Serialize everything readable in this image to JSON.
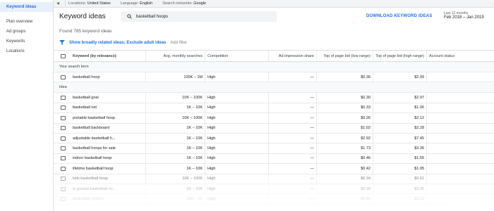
{
  "sidebar": {
    "items": [
      {
        "label": "Keyword ideas",
        "active": true
      },
      {
        "label": "Plan overview",
        "active": false
      },
      {
        "label": "Ad groups",
        "active": false
      },
      {
        "label": "Keywords",
        "active": false
      },
      {
        "label": "Locations",
        "active": false
      }
    ]
  },
  "topbar": {
    "collapse_icon": "◀",
    "locations_label": "Locations:",
    "locations_value": "United States",
    "language_label": "Language:",
    "language_value": "English",
    "networks_label": "Search networks:",
    "networks_value": "Google"
  },
  "header": {
    "title": "Keyword ideas",
    "search_value": "basketball hoops",
    "download_label": "DOWNLOAD KEYWORD IDEAS",
    "date_sub": "Last 12 months",
    "date_value": "Feb 2018 – Jan 2019"
  },
  "found_text": "Found 785 keyword ideas",
  "filter": {
    "broad_label": "Show broadly related ideas; Exclude adult ideas",
    "add_label": "Add filter"
  },
  "table": {
    "headers": {
      "keyword": "Keyword (by relevance)",
      "avg": "Avg. monthly searches",
      "competition": "Competition",
      "impression": "Ad impression share",
      "low": "Top of page bid (low range)",
      "high": "Top of page bid (high range)",
      "account": "Account status"
    },
    "section_search_term": "Your search term",
    "section_ideas": "Idea",
    "search_term_row": {
      "keyword": "basketball hoop",
      "avg": "100K – 1M",
      "competition": "High",
      "impression": "—",
      "low": "$0.36",
      "high": "$2.99"
    },
    "rows": [
      {
        "keyword": "basketball goal",
        "avg": "10K – 100K",
        "competition": "High",
        "impression": "—",
        "low": "$0.30",
        "high": "$2.97"
      },
      {
        "keyword": "basketball net",
        "avg": "1K – 10K",
        "competition": "High",
        "impression": "—",
        "low": "$0.33",
        "high": "$1.06"
      },
      {
        "keyword": "portable basketball hoop",
        "avg": "10K – 100K",
        "competition": "High",
        "impression": "—",
        "low": "$0.26",
        "high": "$2.12"
      },
      {
        "keyword": "basketball backboard",
        "avg": "1K – 10K",
        "competition": "High",
        "impression": "—",
        "low": "$1.02",
        "high": "$2.28"
      },
      {
        "keyword": "adjustable basketball h...",
        "avg": "1K – 10K",
        "competition": "High",
        "impression": "—",
        "low": "$2.92",
        "high": "$7.45"
      },
      {
        "keyword": "basketball hoops for sale",
        "avg": "1K – 10K",
        "competition": "High",
        "impression": "—",
        "low": "$1.73",
        "high": "$3.36"
      },
      {
        "keyword": "indoor basketball hoop",
        "avg": "1K – 10K",
        "competition": "High",
        "impression": "—",
        "low": "$0.46",
        "high": "$1.55"
      },
      {
        "keyword": "lifetime basketball hoop",
        "avg": "1K – 10K",
        "competition": "High",
        "impression": "—",
        "low": "$0.42",
        "high": "$1.95"
      },
      {
        "keyword": "kids basketball hoop",
        "avg": "10K – 100K",
        "competition": "High",
        "impression": "—",
        "low": "$0.34",
        "high": "$0.61"
      },
      {
        "keyword": "in ground basketball ho...",
        "avg": "1K – 10K",
        "competition": "High",
        "impression": "—",
        "low": "$0.28",
        "high": "$3.35"
      },
      {
        "keyword": "basketball system",
        "avg": "100 – 1K",
        "competition": "High",
        "impression": "—",
        "low": "$0.45",
        "high": "$2.10"
      }
    ]
  }
}
